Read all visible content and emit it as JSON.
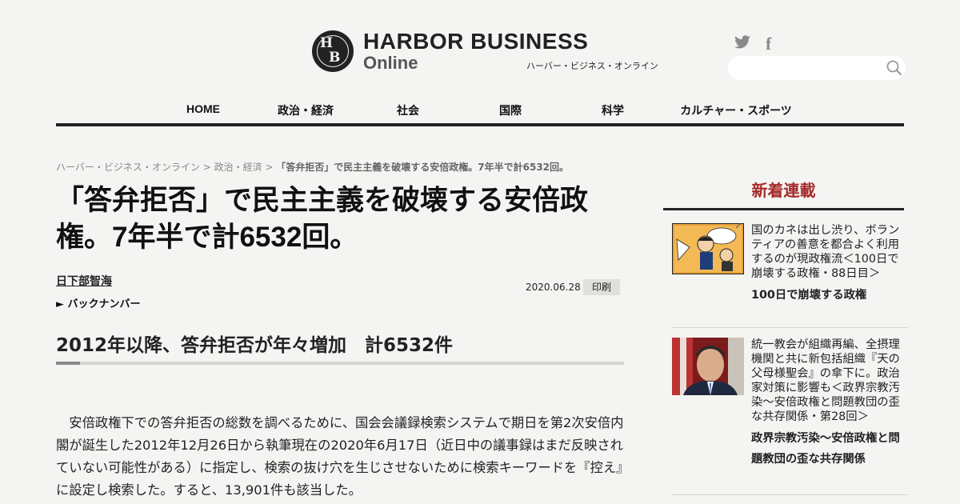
{
  "header": {
    "logo": {
      "mark_top": "H",
      "mark_bottom": "B",
      "name": "HARBOR BUSINESS",
      "sub": "Online",
      "kana": "ハーバー・ビジネス・オンライン"
    },
    "social": {
      "twitter": "twitter-icon",
      "facebook_glyph": "f"
    },
    "search": {
      "placeholder": "",
      "icon": "search-icon"
    }
  },
  "nav": {
    "items": [
      {
        "label": "HOME"
      },
      {
        "label": "政治・経済"
      },
      {
        "label": "社会"
      },
      {
        "label": "国際"
      },
      {
        "label": "科学"
      },
      {
        "label": "カルチャー・スポーツ"
      }
    ]
  },
  "breadcrumb": {
    "home": "ハーバー・ビジネス・オンライン",
    "sep": " > ",
    "section": "政治・経済",
    "current": "「答弁拒否」で民主主義を破壊する安倍政権。7年半で計6532回。"
  },
  "article": {
    "title": "「答弁拒否」で民主主義を破壊する安倍政権。7年半で計6532回。",
    "author": "日下部智海",
    "backnumber": "► バックナンバー",
    "date": "2020.06.28",
    "print_label": "印刷",
    "subhead": "2012年以降、答弁拒否が年々増加　計6532件",
    "body": "　安倍政権下での答弁拒否の総数を調べるために、国会会議録検索システムで期日を第2次安倍内閣が誕生した2012年12月26日から執筆現在の2020年6月17日（近日中の議事録はまだ反映されていない可能性がある）に指定し、検索の抜け穴を生じさせないために検索キーワードを『控え』に設定し検索した。すると、13,901件も該当した。"
  },
  "sidebar": {
    "heading": "新着連載",
    "items": [
      {
        "text": "国のカネは出し渋り、ボランティアの善意を都合よく利用するのが現政権流＜100日で崩壊する政権・88日目＞",
        "series": "100日で崩壊する政権"
      },
      {
        "text": "統一教会が組織再編、全摂理機関と共に新包括組織『天の父母様聖会』の傘下に。政治家対策に影響も＜政界宗教汚染～安倍政権と問題教団の歪な共存関係・第28回＞",
        "series": "政界宗教汚染〜安倍政権と問題教団の歪な共存関係"
      }
    ]
  },
  "colors": {
    "accent": "#a52a2a",
    "rule": "#222222",
    "background": "#f4f4f2"
  }
}
